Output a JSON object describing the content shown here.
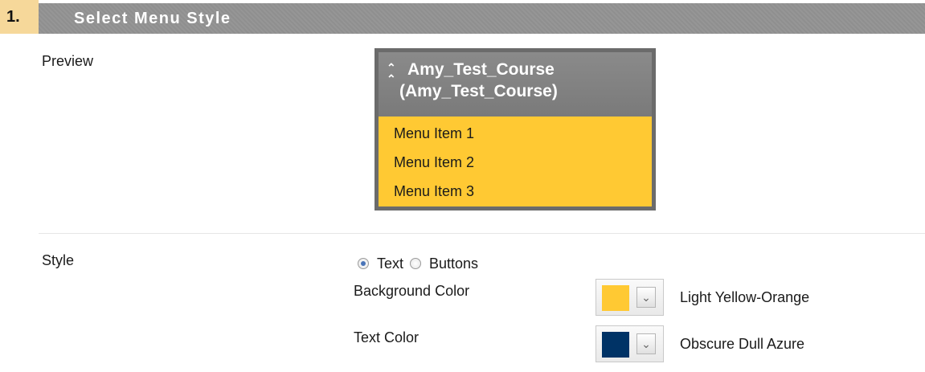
{
  "section": {
    "number": "1.",
    "title": "Select Menu Style"
  },
  "preview": {
    "label": "Preview",
    "collapse_icon": "double-chevron-up-icon",
    "course_line1": "Amy_Test_Course",
    "course_line2": "(Amy_Test_Course)",
    "menu_items": [
      "Menu Item 1",
      "Menu Item 2",
      "Menu Item 3"
    ],
    "colors": {
      "header": "#7f7f7f",
      "border": "#6b6b6b",
      "menu_bg": "#ffc933"
    }
  },
  "style": {
    "label": "Style",
    "options": [
      {
        "label": "Text",
        "checked": true
      },
      {
        "label": "Buttons",
        "checked": false
      }
    ],
    "background_color": {
      "label": "Background Color",
      "value": "Light Yellow-Orange",
      "swatch": "#ffc933",
      "picker_icon": "double-chevron-down-icon"
    },
    "text_color": {
      "label": "Text Color",
      "value": "Obscure Dull Azure",
      "swatch": "#003366",
      "picker_icon": "double-chevron-down-icon"
    }
  },
  "colors": {
    "step_bg": "#f6d89a",
    "header_bar": "#939393"
  }
}
